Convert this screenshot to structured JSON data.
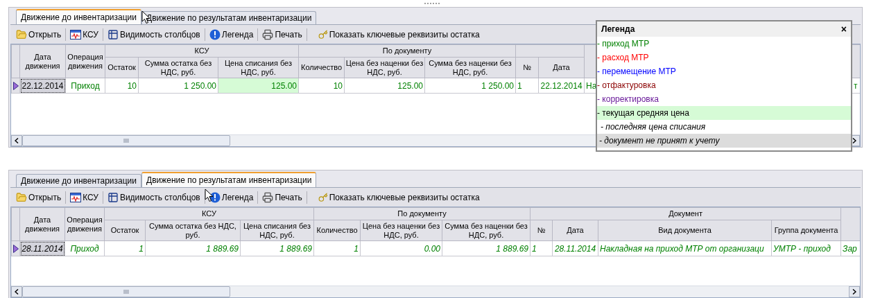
{
  "panels": [
    {
      "tabs": [
        {
          "label": "Движение до инвентаризации",
          "selected": true
        },
        {
          "label": "Движение по результатам инвентаризации",
          "selected": false
        }
      ],
      "toolbar": [
        {
          "label": "Открыть"
        },
        {
          "label": "КСУ"
        },
        {
          "label": "Видимость столбцов"
        },
        {
          "label": "Легенда"
        },
        {
          "label": "Печать"
        },
        {
          "label": "Показать ключевые реквизиты остатка"
        }
      ],
      "grid": {
        "headers": [
          {
            "label": "Дата движения"
          },
          {
            "label": "Операция движения"
          },
          {
            "label": "КСУ",
            "columns": [
              "Остаток",
              "Сумма остатка без НДС, руб.",
              "Цена списания без НДС, руб."
            ]
          },
          {
            "label": "По документу",
            "columns": [
              "Количество",
              "Цена без наценки без НДС, руб.",
              "Сумма без наценки без НДС, руб."
            ]
          },
          {
            "columns": [
              "№",
              "Дата"
            ]
          }
        ],
        "rows": [
          {
            "selected": true,
            "italic": false,
            "color": "#008000",
            "cells": [
              {
                "text": "22.12.2014",
                "highlighted": false
              },
              {
                "text": "Приход",
                "highlighted": false
              },
              {
                "text": "10",
                "highlighted": false
              },
              {
                "text": "1 250.00",
                "highlighted": false
              },
              {
                "text": "125.00",
                "highlighted": true
              },
              {
                "text": "10",
                "highlighted": false
              },
              {
                "text": "125.00",
                "highlighted": false
              },
              {
                "text": "1 250.00",
                "highlighted": false
              },
              {
                "text": "1",
                "highlighted": false
              },
              {
                "text": "22.12.2014",
                "highlighted": false
              },
              {
                "text": "На",
                "highlighted": false
              },
              {
                "text": "т",
                "highlighted": false
              }
            ]
          }
        ]
      },
      "legend": {
        "title": "Легенда",
        "close": "×",
        "items": [
          {
            "label": "- приход МТР",
            "color": "#008000",
            "kind": "plain"
          },
          {
            "label": "- расход МТР",
            "color": "#ff0000",
            "kind": "plain"
          },
          {
            "label": "- перемещение МТР",
            "color": "#0000ff",
            "kind": "plain"
          },
          {
            "label": "- отфактуровка",
            "color": "#8b0000",
            "kind": "plain"
          },
          {
            "label": "- корректировка",
            "color": "#6a1b9a",
            "kind": "plain"
          },
          {
            "label": "- текущая средняя цена",
            "color": "#000000",
            "kind": "highlight"
          },
          {
            "label": "- последняя цена списания",
            "color": "#000000",
            "kind": "italic"
          },
          {
            "label": "- документ не принят к учету",
            "color": "#000000",
            "kind": "shaded"
          }
        ]
      }
    },
    {
      "tabs": [
        {
          "label": "Движение до инвентаризации",
          "selected": false
        },
        {
          "label": "Движение по результатам инвентаризации",
          "selected": true
        }
      ],
      "toolbar": [
        {
          "label": "Открыть"
        },
        {
          "label": "КСУ"
        },
        {
          "label": "Видимость столбцов"
        },
        {
          "label": "Легенда"
        },
        {
          "label": "Печать"
        },
        {
          "label": "Показать ключевые реквизиты остатка"
        }
      ],
      "grid": {
        "headers": [
          {
            "label": "Дата движения"
          },
          {
            "label": "Операция движения"
          },
          {
            "label": "КСУ",
            "columns": [
              "Остаток",
              "Сумма остатка без НДС, руб.",
              "Цена списания без НДС, руб."
            ]
          },
          {
            "label": "По документу",
            "columns": [
              "Количество",
              "Цена без наценки без НДС, руб.",
              "Сумма без наценки без НДС, руб."
            ]
          },
          {
            "label": "Документ",
            "columns": [
              "№",
              "Дата",
              "Вид документа",
              "Группа документа"
            ]
          }
        ],
        "rows": [
          {
            "selected": true,
            "italic": true,
            "color": "#008000",
            "cells": [
              {
                "text": "28.11.2014",
                "highlighted": false
              },
              {
                "text": "Приход",
                "highlighted": false
              },
              {
                "text": "1",
                "highlighted": false
              },
              {
                "text": "1 889.69",
                "highlighted": false
              },
              {
                "text": "1 889.69",
                "highlighted": false
              },
              {
                "text": "1",
                "highlighted": false
              },
              {
                "text": "0.00",
                "highlighted": false
              },
              {
                "text": "1 889.69",
                "highlighted": false
              },
              {
                "text": "1",
                "highlighted": false
              },
              {
                "text": "28.11.2014",
                "highlighted": false
              },
              {
                "text": "Накладная на приход МТР от организаци",
                "highlighted": false
              },
              {
                "text": "УМТР - приход",
                "highlighted": false
              },
              {
                "text": "Зар",
                "highlighted": false
              }
            ]
          }
        ]
      }
    }
  ]
}
